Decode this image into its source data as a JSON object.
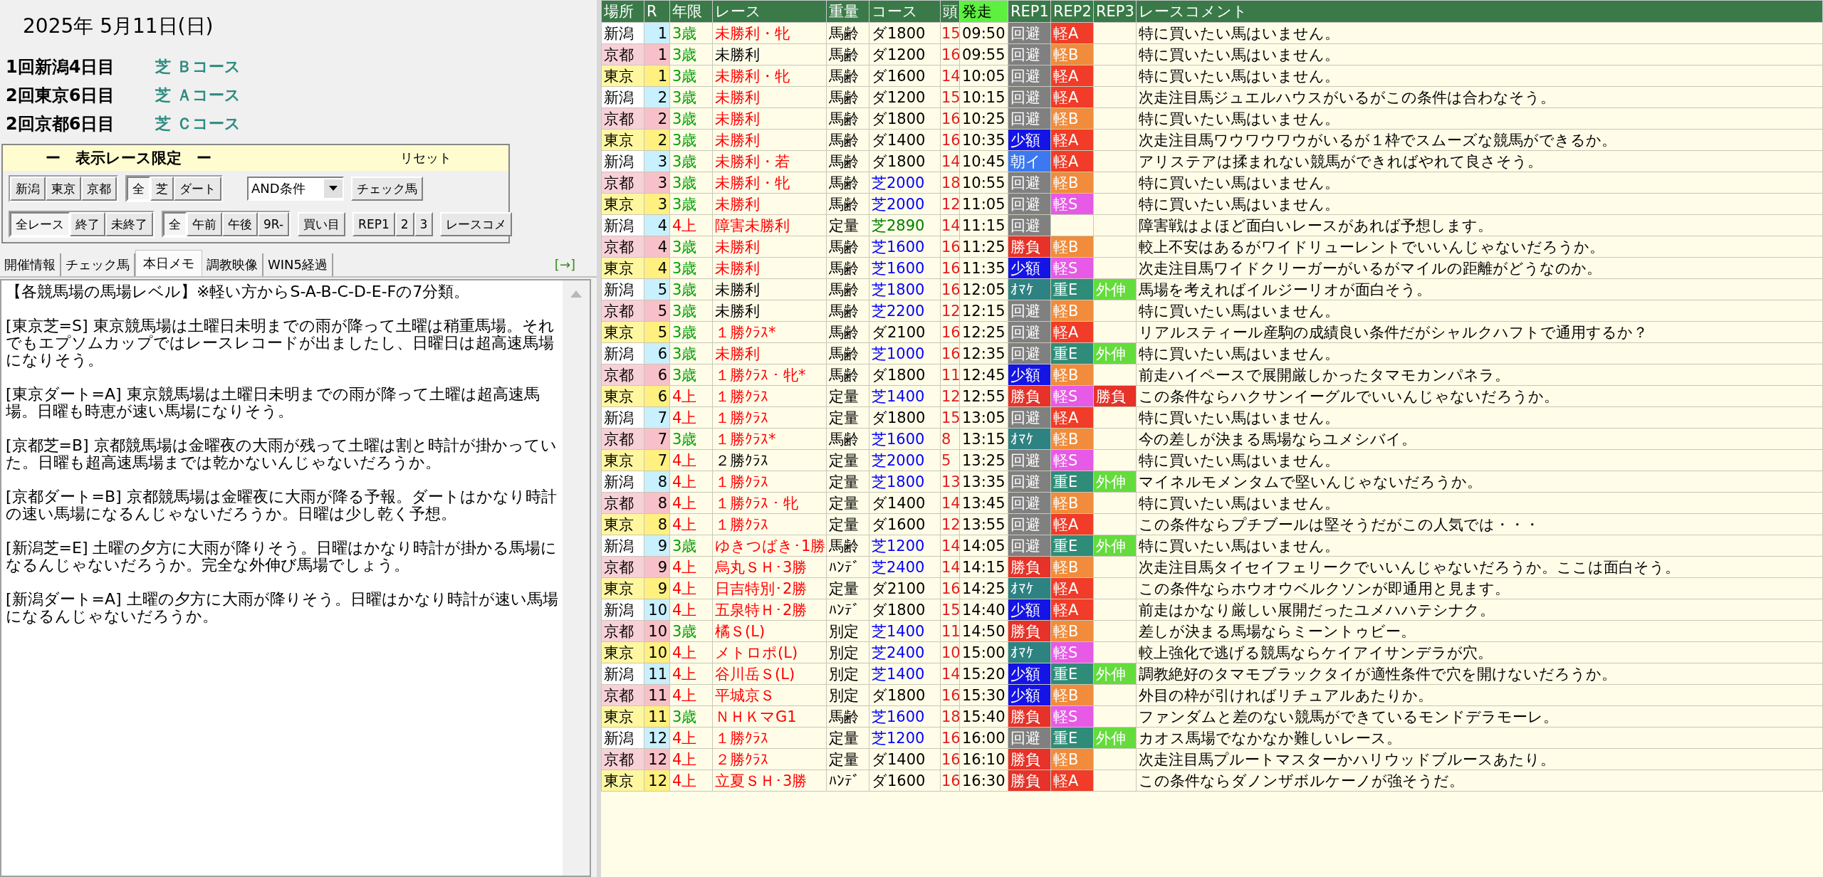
{
  "date": "2025年 5月11日(日)",
  "meetings": [
    {
      "name": "1回新潟4日目",
      "course": "芝 Ｂコース"
    },
    {
      "name": "2回東京6日目",
      "course": "芝 Ａコース"
    },
    {
      "name": "2回京都6日目",
      "course": "芝 Ｃコース"
    }
  ],
  "filter_panel": {
    "title": "ー　表示レース限定　ー",
    "reset": "リセット",
    "rows": [
      [
        {
          "kind": "toggle",
          "items": [
            {
              "label": "新潟",
              "selected": false
            },
            {
              "label": "東京",
              "selected": false
            },
            {
              "label": "京都",
              "selected": false
            }
          ]
        },
        {
          "kind": "toggle",
          "items": [
            {
              "label": "全",
              "selected": true
            },
            {
              "label": "芝",
              "selected": false
            },
            {
              "label": "ダート",
              "selected": false
            }
          ]
        },
        {
          "kind": "dropdown",
          "value": "AND条件"
        },
        {
          "kind": "button",
          "items": [
            {
              "label": "チェック馬"
            }
          ]
        }
      ],
      [
        {
          "kind": "toggle",
          "items": [
            {
              "label": "全レース",
              "selected": true
            },
            {
              "label": "終了",
              "selected": false
            },
            {
              "label": "未終了",
              "selected": false
            }
          ]
        },
        {
          "kind": "toggle",
          "items": [
            {
              "label": "全",
              "selected": true
            },
            {
              "label": "午前",
              "selected": false
            },
            {
              "label": "午後",
              "selected": false
            },
            {
              "label": "9R-",
              "selected": false
            }
          ]
        },
        {
          "kind": "button",
          "items": [
            {
              "label": "買い目"
            }
          ]
        },
        {
          "kind": "button",
          "items": [
            {
              "label": "REP1"
            },
            {
              "label": "2"
            },
            {
              "label": "3"
            }
          ]
        },
        {
          "kind": "button",
          "items": [
            {
              "label": "レースコメ"
            }
          ]
        }
      ]
    ]
  },
  "tabs": [
    {
      "label": "開催情報",
      "selected": false
    },
    {
      "label": "チェック馬",
      "selected": false
    },
    {
      "label": "本日メモ",
      "selected": true
    },
    {
      "label": "調教映像",
      "selected": false
    },
    {
      "label": "WIN5経過",
      "selected": false
    }
  ],
  "expand_link": "[→]",
  "memo": [
    "【各競馬場の馬場レベル】※軽い方からS-A-B-C-D-E-Fの7分類。",
    "[東京芝=S] 東京競馬場は土曜日未明までの雨が降って土曜は稍重馬場。それでもエプソムカップではレースレコードが出ましたし、日曜日は超高速馬場になりそう。",
    "[東京ダート=A] 東京競馬場は土曜日未明までの雨が降って土曜は超高速馬場。日曜も時恵が速い馬場になりそう。",
    "[京都芝=B] 京都競馬場は金曜夜の大雨が残って土曜は割と時計が掛かっていた。日曜も超高速馬場までは乾かないんじゃないだろうか。",
    "[京都ダート=B] 京都競馬場は金曜夜に大雨が降る予報。ダートはかなり時計の速い馬場になるんじゃないだろうか。日曜は少し乾く予想。",
    "[新潟芝=E] 土曜の夕方に大雨が降りそう。日曜はかなり時計が掛かる馬場になるんじゃないだろうか。完全な外伸び馬場でしょう。",
    "[新潟ダート=A] 土曜の夕方に大雨が降りそう。日曜はかなり時計が速い馬場になるんじゃないだろうか。"
  ],
  "table": {
    "columns": [
      "場所",
      "R",
      "年限",
      "レース",
      "重量",
      "コース",
      "頭",
      "発走",
      "REP1",
      "REP2",
      "REP3",
      "レースコメント"
    ],
    "rows": [
      {
        "venue": "新潟",
        "kind": "niigata",
        "r": "1",
        "age": {
          "text": "3歳",
          "color": "#00a000"
        },
        "race": {
          "text": "未勝利・牝",
          "color": "#ff0000"
        },
        "weight": "馬齢",
        "course": {
          "text": "ダ1800",
          "color": "#000000"
        },
        "heads": "15",
        "time": "09:50",
        "rep1": {
          "text": "回避",
          "color": "#808080"
        },
        "rep2": {
          "text": "軽A",
          "color": "#f03c28"
        },
        "comment": "特に買いたい馬はいません。"
      },
      {
        "venue": "京都",
        "kind": "kyoto",
        "r": "1",
        "age": {
          "text": "3歳",
          "color": "#00a000"
        },
        "race": {
          "text": "未勝利",
          "color": "#000000"
        },
        "weight": "馬齢",
        "course": {
          "text": "ダ1200",
          "color": "#000000"
        },
        "heads": "16",
        "time": "09:55",
        "rep1": {
          "text": "回避",
          "color": "#808080"
        },
        "rep2": {
          "text": "軽B",
          "color": "#f08c3c"
        },
        "comment": "特に買いたい馬はいません。"
      },
      {
        "venue": "東京",
        "kind": "tokyo",
        "r": "1",
        "age": {
          "text": "3歳",
          "color": "#00a000"
        },
        "race": {
          "text": "未勝利・牝",
          "color": "#ff0000"
        },
        "weight": "馬齢",
        "course": {
          "text": "ダ1600",
          "color": "#000000"
        },
        "heads": "14",
        "time": "10:05",
        "rep1": {
          "text": "回避",
          "color": "#808080"
        },
        "rep2": {
          "text": "軽A",
          "color": "#f03c28"
        },
        "comment": "特に買いたい馬はいません。"
      },
      {
        "venue": "新潟",
        "kind": "niigata",
        "r": "2",
        "age": {
          "text": "3歳",
          "color": "#00a000"
        },
        "race": {
          "text": "未勝利",
          "color": "#ff0000"
        },
        "weight": "馬齢",
        "course": {
          "text": "ダ1200",
          "color": "#000000"
        },
        "heads": "15",
        "time": "10:15",
        "rep1": {
          "text": "回避",
          "color": "#808080"
        },
        "rep2": {
          "text": "軽A",
          "color": "#f03c28"
        },
        "comment": "次走注目馬ジュエルハウスがいるがこの条件は合わなそう。"
      },
      {
        "venue": "京都",
        "kind": "kyoto",
        "r": "2",
        "age": {
          "text": "3歳",
          "color": "#00a000"
        },
        "race": {
          "text": "未勝利",
          "color": "#ff0000"
        },
        "weight": "馬齢",
        "course": {
          "text": "ダ1800",
          "color": "#000000"
        },
        "heads": "16",
        "time": "10:25",
        "rep1": {
          "text": "回避",
          "color": "#808080"
        },
        "rep2": {
          "text": "軽B",
          "color": "#f08c3c"
        },
        "comment": "特に買いたい馬はいません。"
      },
      {
        "venue": "東京",
        "kind": "tokyo",
        "r": "2",
        "age": {
          "text": "3歳",
          "color": "#00a000"
        },
        "race": {
          "text": "未勝利",
          "color": "#ff0000"
        },
        "weight": "馬齢",
        "course": {
          "text": "ダ1400",
          "color": "#000000"
        },
        "heads": "16",
        "time": "10:35",
        "rep1": {
          "text": "少額",
          "color": "#1414e6"
        },
        "rep2": {
          "text": "軽A",
          "color": "#f03c28"
        },
        "comment": "次走注目馬ワウワウワウがいるが１枠でスムーズな競馬ができるか。"
      },
      {
        "venue": "新潟",
        "kind": "niigata",
        "r": "3",
        "age": {
          "text": "3歳",
          "color": "#00a000"
        },
        "race": {
          "text": "未勝利・若",
          "color": "#ff0000"
        },
        "weight": "馬齢",
        "course": {
          "text": "ダ1800",
          "color": "#000000"
        },
        "heads": "14",
        "time": "10:45",
        "rep1": {
          "text": "朝イ",
          "color": "#3c78f0"
        },
        "rep2": {
          "text": "軽A",
          "color": "#f03c28"
        },
        "comment": "アリステアは揉まれない競馬ができればやれて良さそう。"
      },
      {
        "venue": "京都",
        "kind": "kyoto",
        "r": "3",
        "age": {
          "text": "3歳",
          "color": "#00a000"
        },
        "race": {
          "text": "未勝利・牝",
          "color": "#ff0000"
        },
        "weight": "馬齢",
        "course": {
          "text": "芝2000",
          "color": "#0000ff"
        },
        "heads": "18",
        "time": "10:55",
        "rep1": {
          "text": "回避",
          "color": "#808080"
        },
        "rep2": {
          "text": "軽B",
          "color": "#f08c3c"
        },
        "comment": "特に買いたい馬はいません。"
      },
      {
        "venue": "東京",
        "kind": "tokyo",
        "r": "3",
        "age": {
          "text": "3歳",
          "color": "#00a000"
        },
        "race": {
          "text": "未勝利",
          "color": "#ff0000"
        },
        "weight": "馬齢",
        "course": {
          "text": "芝2000",
          "color": "#0000ff"
        },
        "heads": "12",
        "time": "11:05",
        "rep1": {
          "text": "回避",
          "color": "#808080"
        },
        "rep2": {
          "text": "軽S",
          "color": "#e65ae6"
        },
        "comment": "特に買いたい馬はいません。"
      },
      {
        "venue": "新潟",
        "kind": "niigata",
        "r": "4",
        "age": {
          "text": "4上",
          "color": "#ff0000"
        },
        "race": {
          "text": "障害未勝利",
          "color": "#ff0000"
        },
        "weight": "定量",
        "course": {
          "text": "芝2890",
          "color": "#008000"
        },
        "heads": "14",
        "time": "11:15",
        "rep1": {
          "text": "回避",
          "color": "#808080"
        },
        "comment": "障害戦はよほど面白いレースがあれば予想します。"
      },
      {
        "venue": "京都",
        "kind": "kyoto",
        "r": "4",
        "age": {
          "text": "3歳",
          "color": "#00a000"
        },
        "race": {
          "text": "未勝利",
          "color": "#ff0000"
        },
        "weight": "馬齢",
        "course": {
          "text": "芝1600",
          "color": "#0000ff"
        },
        "heads": "16",
        "time": "11:25",
        "rep1": {
          "text": "勝負",
          "color": "#e63228"
        },
        "rep2": {
          "text": "軽B",
          "color": "#f08c3c"
        },
        "comment": "較上不安はあるがワイドリューレントでいいんじゃないだろうか。"
      },
      {
        "venue": "東京",
        "kind": "tokyo",
        "r": "4",
        "age": {
          "text": "3歳",
          "color": "#00a000"
        },
        "race": {
          "text": "未勝利",
          "color": "#ff0000"
        },
        "weight": "馬齢",
        "course": {
          "text": "芝1600",
          "color": "#0000ff"
        },
        "heads": "16",
        "time": "11:35",
        "rep1": {
          "text": "少額",
          "color": "#1414e6"
        },
        "rep2": {
          "text": "軽S",
          "color": "#e65ae6"
        },
        "comment": "次走注目馬ワイドクリーガーがいるがマイルの距離がどうなのか。"
      },
      {
        "venue": "新潟",
        "kind": "niigata",
        "r": "5",
        "age": {
          "text": "3歳",
          "color": "#00a000"
        },
        "race": {
          "text": "未勝利",
          "color": "#000000"
        },
        "weight": "馬齢",
        "course": {
          "text": "芝1800",
          "color": "#0000ff"
        },
        "heads": "16",
        "time": "12:05",
        "rep1": {
          "text": "ｵﾏｹ",
          "color": "#2e8282"
        },
        "rep2": {
          "text": "重E",
          "color": "#2e8c78"
        },
        "rep3": {
          "text": "外伸",
          "color": "#64dc3c"
        },
        "comment": "馬場を考えればイルジーリオが面白そう。"
      },
      {
        "venue": "京都",
        "kind": "kyoto",
        "r": "5",
        "age": {
          "text": "3歳",
          "color": "#00a000"
        },
        "race": {
          "text": "未勝利",
          "color": "#000000"
        },
        "weight": "馬齢",
        "course": {
          "text": "芝2200",
          "color": "#0000ff"
        },
        "heads": "12",
        "time": "12:15",
        "rep1": {
          "text": "回避",
          "color": "#808080"
        },
        "rep2": {
          "text": "軽B",
          "color": "#f08c3c"
        },
        "comment": "特に買いたい馬はいません。"
      },
      {
        "venue": "東京",
        "kind": "tokyo",
        "r": "5",
        "age": {
          "text": "3歳",
          "color": "#00a000"
        },
        "race": {
          "text": "１勝ｸﾗｽ*",
          "color": "#ff0000"
        },
        "weight": "馬齢",
        "course": {
          "text": "ダ2100",
          "color": "#000000"
        },
        "heads": "16",
        "time": "12:25",
        "rep1": {
          "text": "回避",
          "color": "#808080"
        },
        "rep2": {
          "text": "軽A",
          "color": "#f03c28"
        },
        "comment": "リアルスティール産駒の成績良い条件だがシャルクハフトで通用するか？"
      },
      {
        "venue": "新潟",
        "kind": "niigata",
        "r": "6",
        "age": {
          "text": "3歳",
          "color": "#00a000"
        },
        "race": {
          "text": "未勝利",
          "color": "#ff0000"
        },
        "weight": "馬齢",
        "course": {
          "text": "芝1000",
          "color": "#0000ff"
        },
        "heads": "16",
        "time": "12:35",
        "rep1": {
          "text": "回避",
          "color": "#808080"
        },
        "rep2": {
          "text": "重E",
          "color": "#2e8c78"
        },
        "rep3": {
          "text": "外伸",
          "color": "#64dc3c"
        },
        "comment": "特に買いたい馬はいません。"
      },
      {
        "venue": "京都",
        "kind": "kyoto",
        "r": "6",
        "age": {
          "text": "3歳",
          "color": "#00a000"
        },
        "race": {
          "text": "１勝ｸﾗｽ・牝*",
          "color": "#ff0000"
        },
        "weight": "馬齢",
        "course": {
          "text": "ダ1800",
          "color": "#000000"
        },
        "heads": "11",
        "time": "12:45",
        "rep1": {
          "text": "少額",
          "color": "#1414e6"
        },
        "rep2": {
          "text": "軽B",
          "color": "#f08c3c"
        },
        "comment": "前走ハイペースで展開厳しかったタマモカンパネラ。"
      },
      {
        "venue": "東京",
        "kind": "tokyo",
        "r": "6",
        "age": {
          "text": "4上",
          "color": "#ff0000"
        },
        "race": {
          "text": "１勝ｸﾗｽ",
          "color": "#ff0000"
        },
        "weight": "定量",
        "course": {
          "text": "芝1400",
          "color": "#0000ff"
        },
        "heads": "12",
        "time": "12:55",
        "rep1": {
          "text": "勝負",
          "color": "#e63228"
        },
        "rep2": {
          "text": "軽S",
          "color": "#e65ae6"
        },
        "rep3": {
          "text": "勝負",
          "color": "#e63228"
        },
        "comment": "この条件ならハクサンイーグルでいいんじゃないだろうか。"
      },
      {
        "venue": "新潟",
        "kind": "niigata",
        "r": "7",
        "age": {
          "text": "4上",
          "color": "#ff0000"
        },
        "race": {
          "text": "１勝ｸﾗｽ",
          "color": "#ff0000"
        },
        "weight": "定量",
        "course": {
          "text": "ダ1800",
          "color": "#000000"
        },
        "heads": "15",
        "time": "13:05",
        "rep1": {
          "text": "回避",
          "color": "#808080"
        },
        "rep2": {
          "text": "軽A",
          "color": "#f03c28"
        },
        "comment": "特に買いたい馬はいません。"
      },
      {
        "venue": "京都",
        "kind": "kyoto",
        "r": "7",
        "age": {
          "text": "3歳",
          "color": "#00a000"
        },
        "race": {
          "text": "１勝ｸﾗｽ*",
          "color": "#ff0000"
        },
        "weight": "馬齢",
        "course": {
          "text": "芝1600",
          "color": "#0000ff"
        },
        "heads": "8",
        "time": "13:15",
        "rep1": {
          "text": "ｵﾏｹ",
          "color": "#2e8282"
        },
        "rep2": {
          "text": "軽B",
          "color": "#f08c3c"
        },
        "comment": "今の差しが決まる馬場ならユメシバイ。"
      },
      {
        "venue": "東京",
        "kind": "tokyo",
        "r": "7",
        "age": {
          "text": "4上",
          "color": "#ff0000"
        },
        "race": {
          "text": "２勝ｸﾗｽ",
          "color": "#000000"
        },
        "weight": "定量",
        "course": {
          "text": "芝2000",
          "color": "#0000ff"
        },
        "heads": "5",
        "time": "13:25",
        "rep1": {
          "text": "回避",
          "color": "#808080"
        },
        "rep2": {
          "text": "軽S",
          "color": "#e65ae6"
        },
        "comment": "特に買いたい馬はいません。"
      },
      {
        "venue": "新潟",
        "kind": "niigata",
        "r": "8",
        "age": {
          "text": "4上",
          "color": "#ff0000"
        },
        "race": {
          "text": "１勝ｸﾗｽ",
          "color": "#ff0000"
        },
        "weight": "定量",
        "course": {
          "text": "芝1800",
          "color": "#0000ff"
        },
        "heads": "13",
        "time": "13:35",
        "rep1": {
          "text": "回避",
          "color": "#808080"
        },
        "rep2": {
          "text": "重E",
          "color": "#2e8c78"
        },
        "rep3": {
          "text": "外伸",
          "color": "#64dc3c"
        },
        "comment": "マイネルモメンタムで堅いんじゃないだろうか。"
      },
      {
        "venue": "京都",
        "kind": "kyoto",
        "r": "8",
        "age": {
          "text": "4上",
          "color": "#ff0000"
        },
        "race": {
          "text": "１勝ｸﾗｽ・牝",
          "color": "#ff0000"
        },
        "weight": "定量",
        "course": {
          "text": "ダ1400",
          "color": "#000000"
        },
        "heads": "14",
        "time": "13:45",
        "rep1": {
          "text": "回避",
          "color": "#808080"
        },
        "rep2": {
          "text": "軽B",
          "color": "#f08c3c"
        },
        "comment": "特に買いたい馬はいません。"
      },
      {
        "venue": "東京",
        "kind": "tokyo",
        "r": "8",
        "age": {
          "text": "4上",
          "color": "#ff0000"
        },
        "race": {
          "text": "１勝ｸﾗｽ",
          "color": "#ff0000"
        },
        "weight": "定量",
        "course": {
          "text": "ダ1600",
          "color": "#000000"
        },
        "heads": "12",
        "time": "13:55",
        "rep1": {
          "text": "回避",
          "color": "#808080"
        },
        "rep2": {
          "text": "軽A",
          "color": "#f03c28"
        },
        "comment": "この条件ならプチブールは堅そうだがこの人気では・・・"
      },
      {
        "venue": "新潟",
        "kind": "niigata",
        "r": "9",
        "age": {
          "text": "3歳",
          "color": "#00a000"
        },
        "race": {
          "text": "ゆきつばき･1勝",
          "color": "#ff0000"
        },
        "weight": "馬齢",
        "course": {
          "text": "芝1200",
          "color": "#0000ff"
        },
        "heads": "14",
        "time": "14:05",
        "rep1": {
          "text": "回避",
          "color": "#808080"
        },
        "rep2": {
          "text": "重E",
          "color": "#2e8c78"
        },
        "rep3": {
          "text": "外伸",
          "color": "#64dc3c"
        },
        "comment": "特に買いたい馬はいません。"
      },
      {
        "venue": "京都",
        "kind": "kyoto",
        "r": "9",
        "age": {
          "text": "4上",
          "color": "#ff0000"
        },
        "race": {
          "text": "烏丸ＳＨ･3勝",
          "color": "#ff0000"
        },
        "weight": "ﾊﾝﾃﾞ",
        "course": {
          "text": "芝2400",
          "color": "#0000ff"
        },
        "heads": "14",
        "time": "14:15",
        "rep1": {
          "text": "勝負",
          "color": "#e63228"
        },
        "rep2": {
          "text": "軽B",
          "color": "#f08c3c"
        },
        "comment": "次走注目馬タイセイフェリークでいいんじゃないだろうか。ここは面白そう。"
      },
      {
        "venue": "東京",
        "kind": "tokyo",
        "r": "9",
        "age": {
          "text": "4上",
          "color": "#ff0000"
        },
        "race": {
          "text": "日吉特別･2勝",
          "color": "#ff0000"
        },
        "weight": "定量",
        "course": {
          "text": "ダ2100",
          "color": "#000000"
        },
        "heads": "16",
        "time": "14:25",
        "rep1": {
          "text": "ｵﾏｹ",
          "color": "#2e8282"
        },
        "rep2": {
          "text": "軽A",
          "color": "#f03c28"
        },
        "comment": "この条件ならホウオウベルクソンが即通用と見ます。"
      },
      {
        "venue": "新潟",
        "kind": "niigata",
        "r": "10",
        "age": {
          "text": "4上",
          "color": "#ff0000"
        },
        "race": {
          "text": "五泉特Ｈ･2勝",
          "color": "#ff0000"
        },
        "weight": "ﾊﾝﾃﾞ",
        "course": {
          "text": "ダ1800",
          "color": "#000000"
        },
        "heads": "15",
        "time": "14:40",
        "rep1": {
          "text": "少額",
          "color": "#1414e6"
        },
        "rep2": {
          "text": "軽A",
          "color": "#f03c28"
        },
        "comment": "前走はかなり厳しい展開だったユメハハテシナク。"
      },
      {
        "venue": "京都",
        "kind": "kyoto",
        "r": "10",
        "age": {
          "text": "3歳",
          "color": "#00a000"
        },
        "race": {
          "text": "橘Ｓ(L)",
          "color": "#ff0000"
        },
        "weight": "別定",
        "course": {
          "text": "芝1400",
          "color": "#0000ff"
        },
        "heads": "11",
        "time": "14:50",
        "rep1": {
          "text": "勝負",
          "color": "#e63228"
        },
        "rep2": {
          "text": "軽B",
          "color": "#f08c3c"
        },
        "comment": "差しが決まる馬場ならミーントゥビー。"
      },
      {
        "venue": "東京",
        "kind": "tokyo",
        "r": "10",
        "age": {
          "text": "4上",
          "color": "#ff0000"
        },
        "race": {
          "text": "メトロポ(L)",
          "color": "#ff0000"
        },
        "weight": "別定",
        "course": {
          "text": "芝2400",
          "color": "#0000ff"
        },
        "heads": "10",
        "time": "15:00",
        "rep1": {
          "text": "ｵﾏｹ",
          "color": "#2e8282"
        },
        "rep2": {
          "text": "軽S",
          "color": "#e65ae6"
        },
        "comment": "較上強化で逃げる競馬ならケイアイサンデラが穴。"
      },
      {
        "venue": "新潟",
        "kind": "niigata",
        "r": "11",
        "age": {
          "text": "4上",
          "color": "#ff0000"
        },
        "race": {
          "text": "谷川岳Ｓ(L)",
          "color": "#ff0000"
        },
        "weight": "別定",
        "course": {
          "text": "芝1400",
          "color": "#0000ff"
        },
        "heads": "14",
        "time": "15:20",
        "rep1": {
          "text": "少額",
          "color": "#1414e6"
        },
        "rep2": {
          "text": "重E",
          "color": "#2e8c78"
        },
        "rep3": {
          "text": "外伸",
          "color": "#64dc3c"
        },
        "comment": "調教絶好のタマモブラックタイが適性条件で穴を開けないだろうか。"
      },
      {
        "venue": "京都",
        "kind": "kyoto",
        "r": "11",
        "age": {
          "text": "4上",
          "color": "#ff0000"
        },
        "race": {
          "text": "平城京Ｓ",
          "color": "#ff0000"
        },
        "weight": "別定",
        "course": {
          "text": "ダ1800",
          "color": "#000000"
        },
        "heads": "16",
        "time": "15:30",
        "rep1": {
          "text": "少額",
          "color": "#1414e6"
        },
        "rep2": {
          "text": "軽B",
          "color": "#f08c3c"
        },
        "comment": "外目の枠が引ければリチュアルあたりか。"
      },
      {
        "venue": "東京",
        "kind": "tokyo",
        "r": "11",
        "age": {
          "text": "3歳",
          "color": "#00a000"
        },
        "race": {
          "text": "ＮＨＫマG1",
          "color": "#ff0000"
        },
        "weight": "馬齢",
        "course": {
          "text": "芝1600",
          "color": "#0000ff"
        },
        "heads": "18",
        "time": "15:40",
        "rep1": {
          "text": "勝負",
          "color": "#e63228"
        },
        "rep2": {
          "text": "軽S",
          "color": "#e65ae6"
        },
        "comment": "ファンダムと差のない競馬ができているモンドデラモーレ。"
      },
      {
        "venue": "新潟",
        "kind": "niigata",
        "r": "12",
        "age": {
          "text": "4上",
          "color": "#ff0000"
        },
        "race": {
          "text": "１勝ｸﾗｽ",
          "color": "#ff0000"
        },
        "weight": "定量",
        "course": {
          "text": "芝1200",
          "color": "#0000ff"
        },
        "heads": "16",
        "time": "16:00",
        "rep1": {
          "text": "回避",
          "color": "#808080"
        },
        "rep2": {
          "text": "重E",
          "color": "#2e8c78"
        },
        "rep3": {
          "text": "外伸",
          "color": "#64dc3c"
        },
        "comment": "カオス馬場でなかなか難しいレース。"
      },
      {
        "venue": "京都",
        "kind": "kyoto",
        "r": "12",
        "age": {
          "text": "4上",
          "color": "#ff0000"
        },
        "race": {
          "text": "２勝ｸﾗｽ",
          "color": "#ff0000"
        },
        "weight": "定量",
        "course": {
          "text": "ダ1400",
          "color": "#000000"
        },
        "heads": "16",
        "time": "16:10",
        "rep1": {
          "text": "勝負",
          "color": "#e63228"
        },
        "rep2": {
          "text": "軽B",
          "color": "#f08c3c"
        },
        "comment": "次走注目馬プルートマスターかハリウッドブルースあたり。"
      },
      {
        "venue": "東京",
        "kind": "tokyo",
        "r": "12",
        "age": {
          "text": "4上",
          "color": "#ff0000"
        },
        "race": {
          "text": "立夏ＳＨ･3勝",
          "color": "#ff0000"
        },
        "weight": "ﾊﾝﾃﾞ",
        "course": {
          "text": "ダ1600",
          "color": "#000000"
        },
        "heads": "16",
        "time": "16:30",
        "rep1": {
          "text": "勝負",
          "color": "#e63228"
        },
        "rep2": {
          "text": "軽A",
          "color": "#f03c28"
        },
        "comment": "この条件ならダノンザボルケーノが強そうだ。"
      }
    ]
  }
}
